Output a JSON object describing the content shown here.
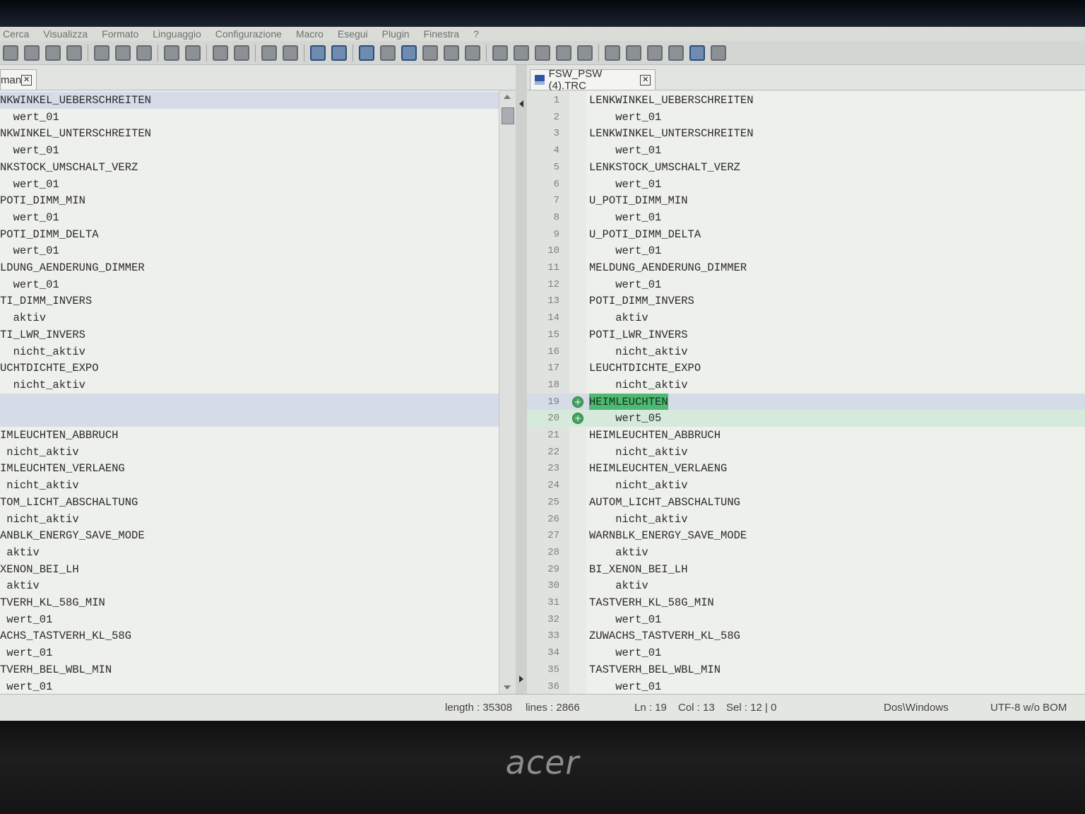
{
  "menu": [
    "Cerca",
    "Visualizza",
    "Formato",
    "Linguaggio",
    "Configurazione",
    "Macro",
    "Esegui",
    "Plugin",
    "Finestra",
    "?"
  ],
  "brand": "acer",
  "tabs": {
    "left": {
      "label": "man"
    },
    "right": {
      "label": "FSW_PSW (4).TRC"
    }
  },
  "left_pane": {
    "lines": [
      "NKWINKEL_UEBERSCHREITEN",
      "  wert_01",
      "NKWINKEL_UNTERSCHREITEN",
      "  wert_01",
      "NKSTOCK_UMSCHALT_VERZ",
      "  wert_01",
      "POTI_DIMM_MIN",
      "  wert_01",
      "POTI_DIMM_DELTA",
      "  wert_01",
      "LDUNG_AENDERUNG_DIMMER",
      "  wert_01",
      "TI_DIMM_INVERS",
      "  aktiv",
      "TI_LWR_INVERS",
      "  nicht_aktiv",
      "UCHTDICHTE_EXPO",
      "  nicht_aktiv",
      "",
      "",
      "IMLEUCHTEN_ABBRUCH",
      " nicht_aktiv",
      "IMLEUCHTEN_VERLAENG",
      " nicht_aktiv",
      "TOM_LICHT_ABSCHALTUNG",
      " nicht_aktiv",
      "ANBLK_ENERGY_SAVE_MODE",
      " aktiv",
      "XENON_BEI_LH",
      " aktiv",
      "TVERH_KL_58G_MIN",
      " wert_01",
      "ACHS_TASTVERH_KL_58G",
      " wert_01",
      "TVERH_BEL_WBL_MIN",
      " wert_01"
    ]
  },
  "right_pane": {
    "lines": [
      {
        "n": "1",
        "t": "LENKWINKEL_UEBERSCHREITEN"
      },
      {
        "n": "2",
        "t": "    wert_01"
      },
      {
        "n": "3",
        "t": "LENKWINKEL_UNTERSCHREITEN"
      },
      {
        "n": "4",
        "t": "    wert_01"
      },
      {
        "n": "5",
        "t": "LENKSTOCK_UMSCHALT_VERZ"
      },
      {
        "n": "6",
        "t": "    wert_01"
      },
      {
        "n": "7",
        "t": "U_POTI_DIMM_MIN"
      },
      {
        "n": "8",
        "t": "    wert_01"
      },
      {
        "n": "9",
        "t": "U_POTI_DIMM_DELTA"
      },
      {
        "n": "10",
        "t": "    wert_01"
      },
      {
        "n": "11",
        "t": "MELDUNG_AENDERUNG_DIMMER"
      },
      {
        "n": "12",
        "t": "    wert_01"
      },
      {
        "n": "13",
        "t": "POTI_DIMM_INVERS"
      },
      {
        "n": "14",
        "t": "    aktiv"
      },
      {
        "n": "15",
        "t": "POTI_LWR_INVERS"
      },
      {
        "n": "16",
        "t": "    nicht_aktiv"
      },
      {
        "n": "17",
        "t": "LEUCHTDICHTE_EXPO"
      },
      {
        "n": "18",
        "t": "    nicht_aktiv"
      },
      {
        "n": "19",
        "t": "HEIMLEUCHTEN"
      },
      {
        "n": "20",
        "t": "    wert_05"
      },
      {
        "n": "21",
        "t": "HEIMLEUCHTEN_ABBRUCH"
      },
      {
        "n": "22",
        "t": "    nicht_aktiv"
      },
      {
        "n": "23",
        "t": "HEIMLEUCHTEN_VERLAENG"
      },
      {
        "n": "24",
        "t": "    nicht_aktiv"
      },
      {
        "n": "25",
        "t": "AUTOM_LICHT_ABSCHALTUNG"
      },
      {
        "n": "26",
        "t": "    nicht_aktiv"
      },
      {
        "n": "27",
        "t": "WARNBLK_ENERGY_SAVE_MODE"
      },
      {
        "n": "28",
        "t": "    aktiv"
      },
      {
        "n": "29",
        "t": "BI_XENON_BEI_LH"
      },
      {
        "n": "30",
        "t": "    aktiv"
      },
      {
        "n": "31",
        "t": "TASTVERH_KL_58G_MIN"
      },
      {
        "n": "32",
        "t": "    wert_01"
      },
      {
        "n": "33",
        "t": "ZUWACHS_TASTVERH_KL_58G"
      },
      {
        "n": "34",
        "t": "    wert_01"
      },
      {
        "n": "35",
        "t": "TASTVERH_BEL_WBL_MIN"
      },
      {
        "n": "36",
        "t": "    wert_01"
      }
    ]
  },
  "status": {
    "length": "length : 35308",
    "lines": "lines : 2866",
    "ln": "Ln : 19",
    "col": "Col : 13",
    "sel": "Sel : 12 | 0",
    "eol": "Dos\\Windows",
    "encoding": "UTF-8 w/o BOM"
  },
  "colors": {
    "accent_selection": "#4fb872",
    "current_line": "#d6dbe8"
  }
}
